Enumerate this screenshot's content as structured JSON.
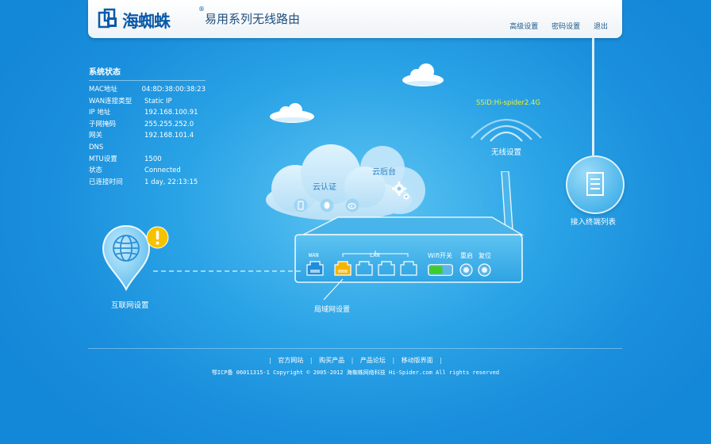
{
  "brand": {
    "logo_text": "海蜘蛛",
    "reg": "®",
    "product_title": "易用系列无线路由"
  },
  "nav": [
    "高级设置",
    "密码设置",
    "退出"
  ],
  "status": {
    "title": "系统状态",
    "rows": [
      {
        "k": "MAC地址",
        "v": "04:8D:38:00:38:23"
      },
      {
        "k": "WAN连接类型",
        "v": "Static IP"
      },
      {
        "k": "IP 地址",
        "v": "192.168.100.91"
      },
      {
        "k": "子网掩码",
        "v": "255.255.252.0"
      },
      {
        "k": "网关",
        "v": "192.168.101.4"
      },
      {
        "k": "DNS",
        "v": ""
      },
      {
        "k": "MTU设置",
        "v": "1500"
      },
      {
        "k": "状态",
        "v": "Connected"
      },
      {
        "k": "已连接时间",
        "v": "1 day, 22:13:15"
      }
    ]
  },
  "cloud": {
    "auth_label": "云认证",
    "platform_label": "云后台"
  },
  "wifi": {
    "ssid": "SSID:Hi-spider2.4G",
    "label": "无线设置"
  },
  "router": {
    "wan": "WAN",
    "lan": "LAN",
    "wifi_switch": "Wifi开关",
    "restart": "重启",
    "reset": "复位",
    "lan_label": "局域网设置"
  },
  "internet": {
    "label": "互联网设置"
  },
  "devices": {
    "label": "接入终端列表"
  },
  "footer": {
    "links": [
      "官方网站",
      "购买产品",
      "产品论坛",
      "移动版界面"
    ],
    "copyright": "鄂ICP备 06011315-1 Copyright © 2005-2012 海蜘蛛网络科技 Hi-Spider.com All rights reserved"
  },
  "colors": {
    "bg": "#1a8fdc",
    "wan_port": "#1f8ddb",
    "lan_active": "#f5b400",
    "wifi_on": "#3fcc2a",
    "ssid": "#f4f02a",
    "warn": "#f5c200"
  }
}
